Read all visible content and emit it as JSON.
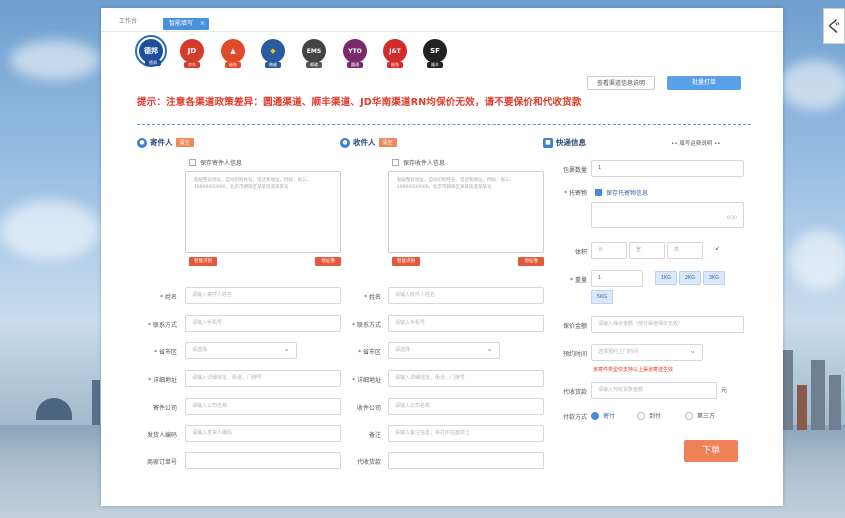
{
  "header": {
    "breadcrumb": "工作台",
    "active_tab": "智能填写",
    "tab_close": "×"
  },
  "carriers": [
    {
      "name": "德邦",
      "color": "#1e4f9c",
      "caption": "德邦"
    },
    {
      "name": "JD",
      "color": "#d33b2c",
      "caption": "京东"
    },
    {
      "name": "▲",
      "color": "#e04a2a",
      "caption": "极兔"
    },
    {
      "name": "◆",
      "color": "#2a5aa0",
      "caption": "跨越"
    },
    {
      "name": "EMS",
      "color": "#444",
      "caption": "邮政"
    },
    {
      "name": "YTO",
      "color": "#7a2a6a",
      "caption": "圆通"
    },
    {
      "name": "J&T",
      "color": "#d32a2a",
      "caption": "极兔"
    },
    {
      "name": "SF",
      "color": "#222",
      "caption": "顺丰"
    }
  ],
  "buttons": {
    "query_label": "查看渠道信息说明",
    "batch_label": "批量打单",
    "submit_label": "下单"
  },
  "notice": "提示：注意各渠道政策差异：圆通渠道、顺丰渠道、JD华南渠道RN均保价无效，请不要保价和代收货款",
  "sender": {
    "title": "寄件人",
    "badge": "清空",
    "save_label": "保存寄件人信息",
    "paste_placeholder": "粘贴整段地址，自动识别姓名、电话和地址，例如：张三，18800000000，北京市朝阳区某某街道某某号",
    "left_mini": "智能识别",
    "right_mini": "地址簿",
    "fields": [
      {
        "label": "* 姓名",
        "placeholder": "请输入寄件人姓名"
      },
      {
        "label": "* 联系方式",
        "placeholder": "请输入手机号"
      },
      {
        "label": "* 省市区",
        "placeholder": "请选择"
      },
      {
        "label": "* 详细地址",
        "placeholder": "请输入详细地址，街道、门牌号"
      },
      {
        "label": "寄件公司",
        "placeholder": "请输入公司名称"
      },
      {
        "label": "发货人编码",
        "placeholder": "请输入发货人编码"
      },
      {
        "label": "商家订单号",
        "placeholder": ""
      }
    ]
  },
  "receiver": {
    "title": "收件人",
    "badge": "清空",
    "save_label": "保存收件人信息",
    "paste_placeholder": "粘贴整段地址，自动识别姓名、电话和地址，例如：张三，18800000000，北京市朝阳区某某街道某某号",
    "left_mini": "智能识别",
    "right_mini": "地址簿",
    "fields": [
      {
        "label": "* 姓名",
        "placeholder": "请输入收件人姓名"
      },
      {
        "label": "* 联系方式",
        "placeholder": "请输入手机号"
      },
      {
        "label": "* 省市区",
        "placeholder": "请选择"
      },
      {
        "label": "* 详细地址",
        "placeholder": "请输入详细地址，街道、门牌号"
      },
      {
        "label": "收件公司",
        "placeholder": "请输入公司名称"
      },
      {
        "label": "备注",
        "placeholder": "请输入备注信息，将打印在面单上"
      },
      {
        "label": "代收货款",
        "placeholder": ""
      }
    ]
  },
  "package": {
    "title": "快递信息",
    "link": "•• 填写运费说明 ••",
    "count_label": "包裹数量",
    "count_value": "1",
    "goods_label": "* 托寄物",
    "goods_checkbox": "保存托寄物信息",
    "goods_counter": "0/30",
    "dims_label": "体积",
    "dims": [
      "长",
      "宽",
      "高"
    ],
    "weight_label": "* 重量",
    "weight_value": "1",
    "weight_tags": [
      "1KG",
      "2KG",
      "3KG",
      "5KG"
    ],
    "insure_label": "保价金额",
    "insure_placeholder": "请输入保价金额（部分渠道保价无效）",
    "time_label": "预约时间",
    "time_placeholder": "选择预约上门时间",
    "red_note": "该寄件类型仅支持以上渠道寄送生效",
    "cod_label": "代收货款",
    "cod_placeholder": "请输入代收货款金额",
    "cod_unit": "元",
    "pay_label": "付款方式",
    "pay_options": [
      "寄付",
      "到付",
      "第三方"
    ]
  }
}
